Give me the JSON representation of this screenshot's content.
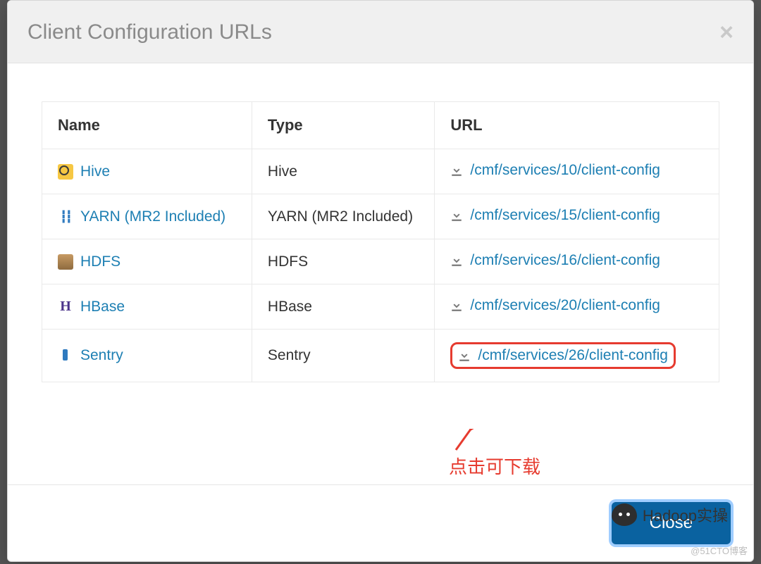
{
  "modal": {
    "title": "Client Configuration URLs",
    "close_label": "Close"
  },
  "columns": {
    "name": "Name",
    "type": "Type",
    "url": "URL"
  },
  "rows": [
    {
      "name": "Hive",
      "type": "Hive",
      "url": "/cmf/services/10/client-config",
      "icon": "hive"
    },
    {
      "name": "YARN (MR2 Included)",
      "type": "YARN (MR2 Included)",
      "url": "/cmf/services/15/client-config",
      "icon": "yarn"
    },
    {
      "name": "HDFS",
      "type": "HDFS",
      "url": "/cmf/services/16/client-config",
      "icon": "hdfs"
    },
    {
      "name": "HBase",
      "type": "HBase",
      "url": "/cmf/services/20/client-config",
      "icon": "hbase"
    },
    {
      "name": "Sentry",
      "type": "Sentry",
      "url": "/cmf/services/26/client-config",
      "icon": "sentry",
      "highlight": true
    }
  ],
  "annotation": {
    "text": "点击可下载"
  },
  "watermark": {
    "chat": "Hadoop实操",
    "corner": "@51CTO博客"
  }
}
